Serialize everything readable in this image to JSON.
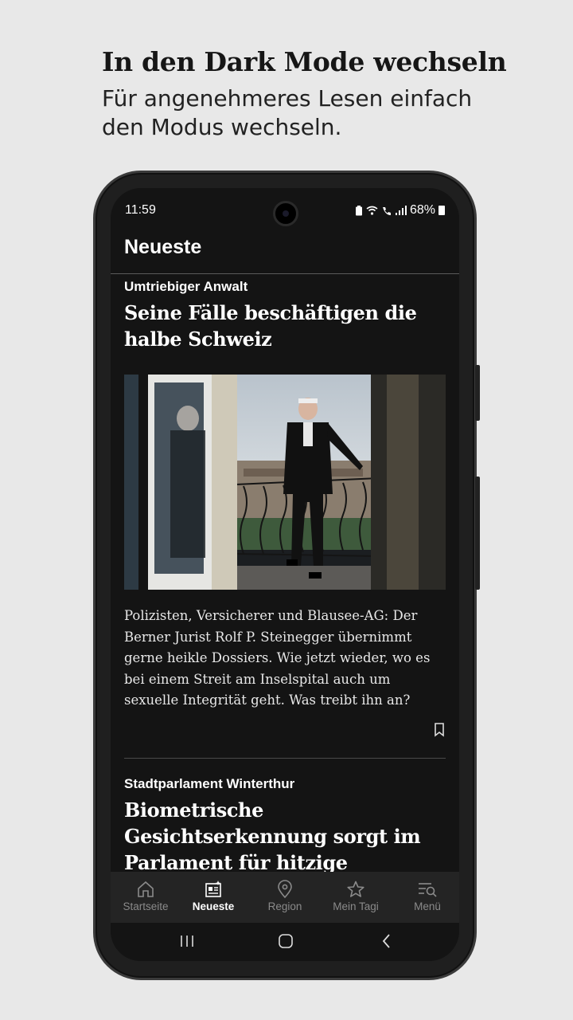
{
  "promo": {
    "title": "In den Dark Mode wechseln",
    "subtitle": "Für angenehmeres Lesen einfach den Modus wechseln."
  },
  "status_bar": {
    "time": "11:59",
    "battery": "68%"
  },
  "header": {
    "title": "Neueste"
  },
  "articles": [
    {
      "kicker": "Umtriebiger Anwalt",
      "headline": "Seine Fälle beschäftigen die halbe Schweiz",
      "lead": "Polizisten, Versicherer und Blausee-AG: Der Berner Jurist Rolf P. Steinegger übernimmt gerne heikle Dossiers. Wie jetzt wieder, wo es bei einem Streit am Inselspital auch um sexuelle Integrität geht. Was treibt ihn an?"
    },
    {
      "kicker": "Stadtparlament Winterthur",
      "headline": "Biometrische Gesichtserkennung sorgt im Parlament für hitzige Diskussion"
    }
  ],
  "tabs": [
    {
      "label": "Startseite",
      "icon": "home-icon"
    },
    {
      "label": "Neueste",
      "icon": "newspaper-icon",
      "active": true
    },
    {
      "label": "Region",
      "icon": "location-pin-icon"
    },
    {
      "label": "Mein Tagi",
      "icon": "star-icon"
    },
    {
      "label": "Menü",
      "icon": "menu-search-icon"
    }
  ],
  "colors": {
    "background": "#e8e8e8",
    "screen": "#141414",
    "tabbar": "#242424",
    "active_tab": "#ffffff",
    "inactive_tab": "#8a8a8a"
  }
}
